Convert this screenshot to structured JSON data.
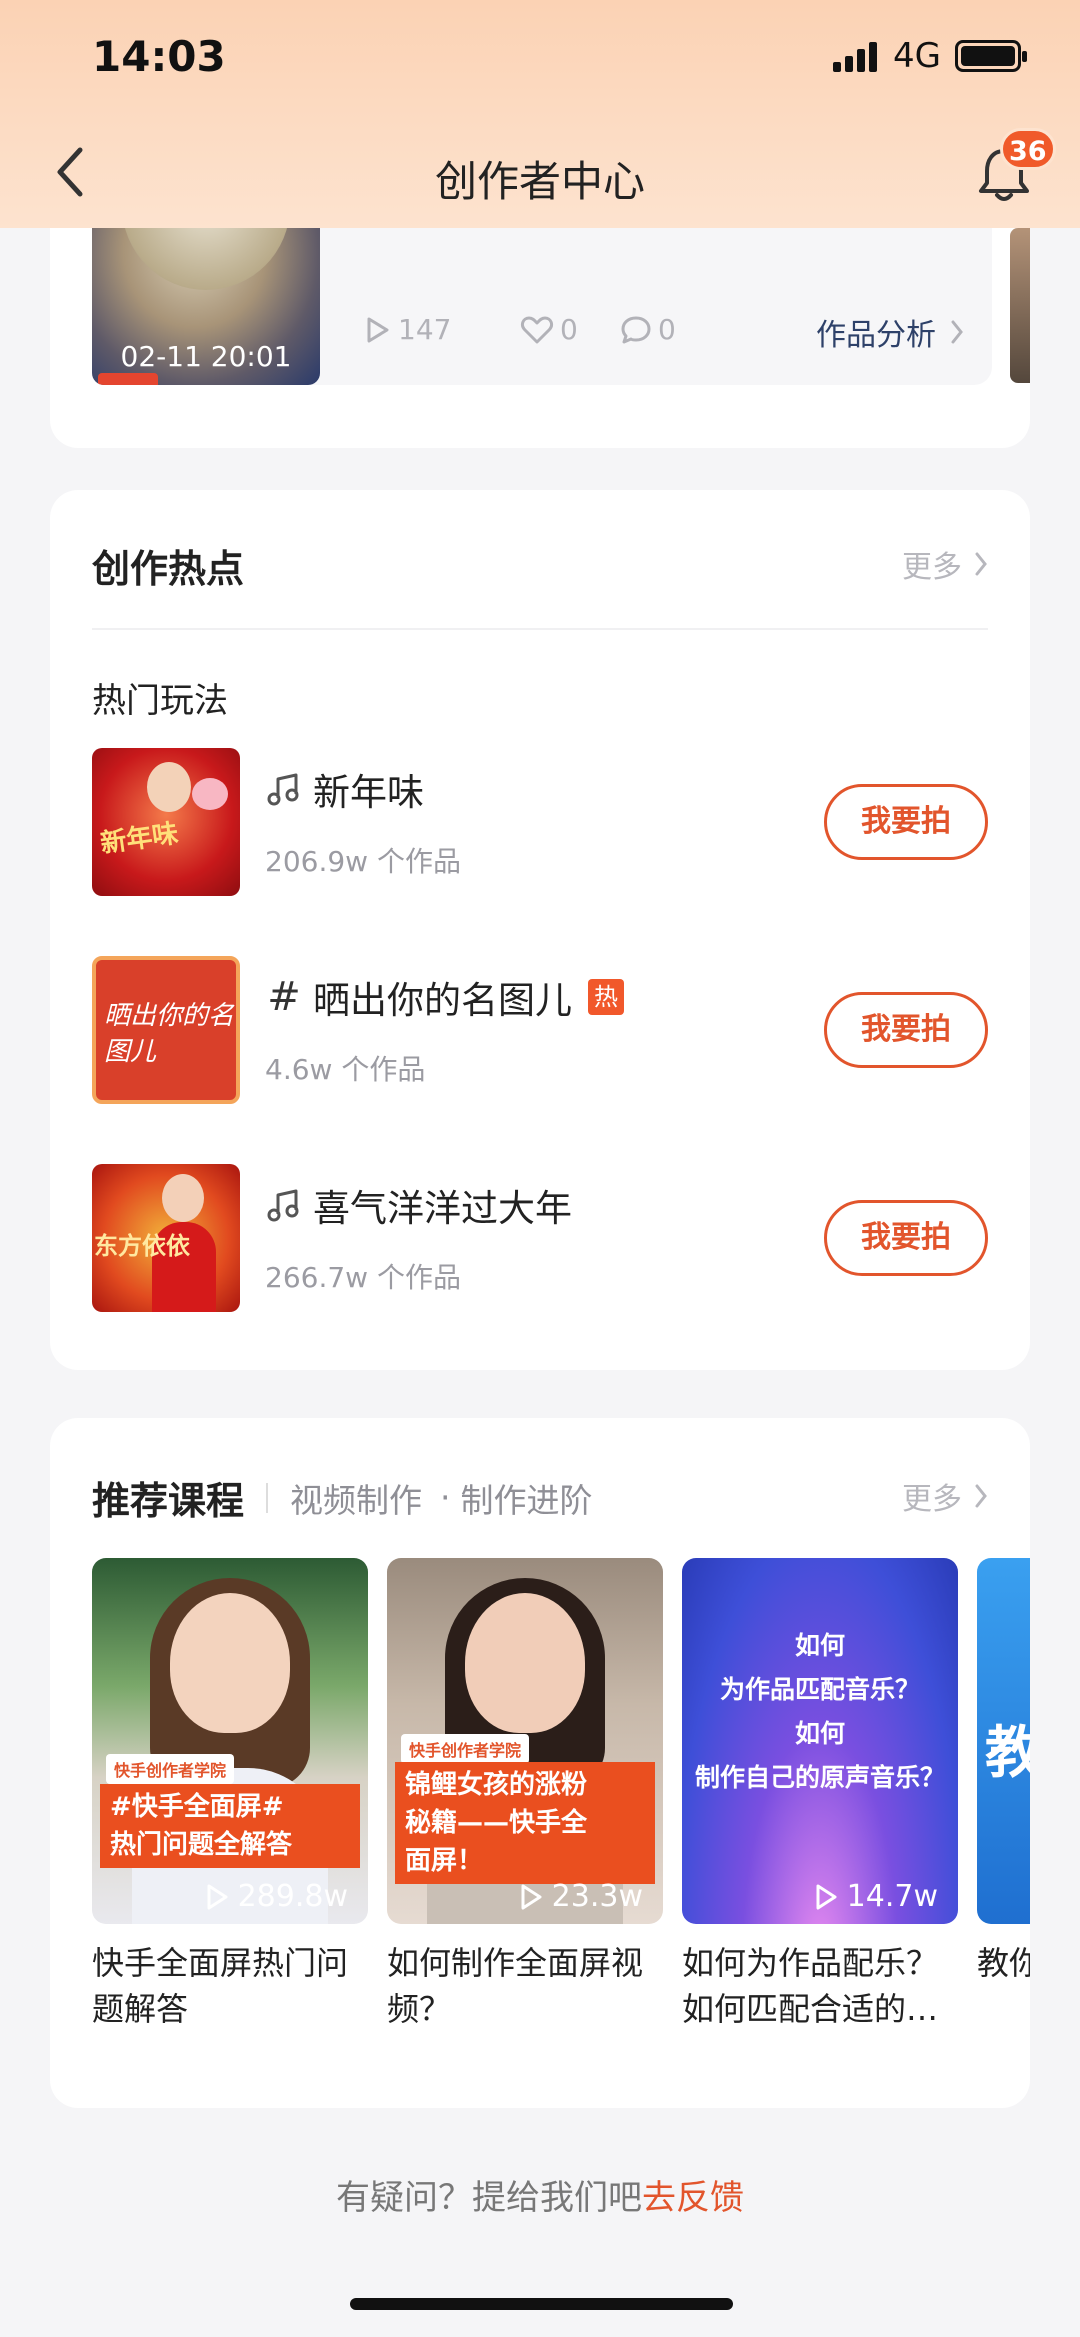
{
  "status_bar": {
    "time": "14:03",
    "network": "4G"
  },
  "nav": {
    "title": "创作者中心",
    "notification_count": "36"
  },
  "recent_work": {
    "date": "02-11  20:01",
    "plays": "147",
    "likes": "0",
    "comments": "0",
    "analysis_label": "作品分析"
  },
  "hotspot": {
    "title": "创作热点",
    "more": "更多",
    "subtitle": "热门玩法",
    "items": [
      {
        "type": "music",
        "name": "新年味",
        "count": "206.9w 个作品",
        "hot": "",
        "action": "我要拍",
        "thumb_text": "新年味"
      },
      {
        "type": "topic",
        "name": "晒出你的名图儿",
        "count": "4.6w 个作品",
        "hot": "热",
        "action": "我要拍",
        "thumb_text": "晒出你的名图儿"
      },
      {
        "type": "music",
        "name": "喜气洋洋过大年",
        "count": "266.7w 个作品",
        "hot": "",
        "action": "我要拍",
        "thumb_text": "东方依依"
      }
    ]
  },
  "courses": {
    "title": "推荐课程",
    "tabs": [
      "视频制作",
      "制作进阶"
    ],
    "more": "更多",
    "items": [
      {
        "academy": "快手创作者学院",
        "overlay": "#快手全面屏#\n热门问题全解答",
        "plays": "289.8w",
        "name": "快手全面屏热门问题解答"
      },
      {
        "academy": "快手创作者学院",
        "overlay": "锦鲤女孩的涨粉\n秘籍——快手全\n面屏！",
        "plays": "23.3w",
        "name": "如何制作全面屏视频？"
      },
      {
        "academy": "",
        "overlay": "如何\n为作品匹配音乐？\n如何\n制作自己的原声音乐？",
        "plays": "14.7w",
        "name": "如何为作品配乐？如何匹配合适的…"
      },
      {
        "academy": "",
        "overlay": "教",
        "plays": "",
        "name": "教你"
      }
    ]
  },
  "feedback": {
    "text": "有疑问？提给我们吧",
    "link": "去反馈"
  },
  "colors": {
    "accent": "#e2552c",
    "header_bg": "#fbd2b4",
    "page_bg": "#f5f5f7"
  }
}
